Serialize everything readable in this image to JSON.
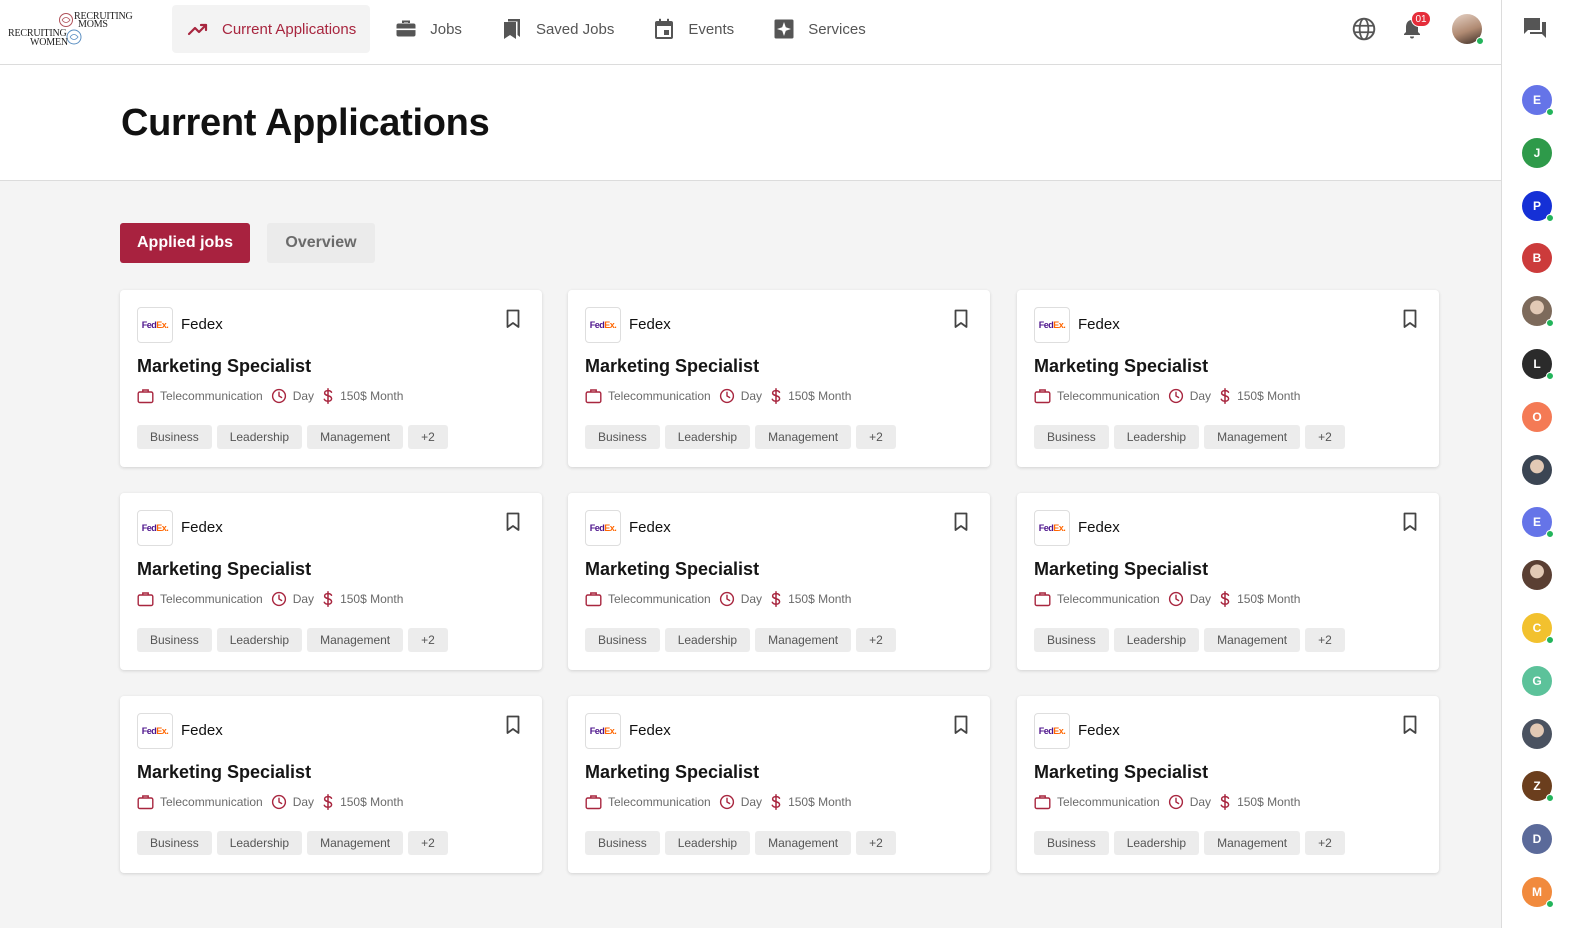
{
  "logo": {
    "line1": "RECRUITING",
    "line2": "MOMS",
    "line3": "RECRUITING",
    "line4": "WOMEN"
  },
  "nav": {
    "items": [
      {
        "label": "Current Applications",
        "icon": "trending-up-icon"
      },
      {
        "label": "Jobs",
        "icon": "briefcase-icon"
      },
      {
        "label": "Saved Jobs",
        "icon": "bookmarks-icon"
      },
      {
        "label": "Events",
        "icon": "calendar-icon"
      },
      {
        "label": "Services",
        "icon": "sparkle-icon"
      }
    ],
    "notification_count": "01",
    "colors": {
      "accent": "#a8263f",
      "online": "#23b45b"
    }
  },
  "page": {
    "title": "Current Applications"
  },
  "tabs": {
    "applied": "Applied jobs",
    "overview": "Overview"
  },
  "jobs": [
    {
      "company": "Fedex",
      "logo_fe": "Fed",
      "logo_ex": "Ex.",
      "title": "Marketing Specialist",
      "industry": "Telecommunication",
      "shift": "Day",
      "salary": "150$ Month",
      "tags": [
        "Business",
        "Leadership",
        "Management",
        "+2"
      ]
    },
    {
      "company": "Fedex",
      "logo_fe": "Fed",
      "logo_ex": "Ex.",
      "title": "Marketing Specialist",
      "industry": "Telecommunication",
      "shift": "Day",
      "salary": "150$ Month",
      "tags": [
        "Business",
        "Leadership",
        "Management",
        "+2"
      ]
    },
    {
      "company": "Fedex",
      "logo_fe": "Fed",
      "logo_ex": "Ex.",
      "title": "Marketing Specialist",
      "industry": "Telecommunication",
      "shift": "Day",
      "salary": "150$ Month",
      "tags": [
        "Business",
        "Leadership",
        "Management",
        "+2"
      ]
    },
    {
      "company": "Fedex",
      "logo_fe": "Fed",
      "logo_ex": "Ex.",
      "title": "Marketing Specialist",
      "industry": "Telecommunication",
      "shift": "Day",
      "salary": "150$ Month",
      "tags": [
        "Business",
        "Leadership",
        "Management",
        "+2"
      ]
    },
    {
      "company": "Fedex",
      "logo_fe": "Fed",
      "logo_ex": "Ex.",
      "title": "Marketing Specialist",
      "industry": "Telecommunication",
      "shift": "Day",
      "salary": "150$ Month",
      "tags": [
        "Business",
        "Leadership",
        "Management",
        "+2"
      ]
    },
    {
      "company": "Fedex",
      "logo_fe": "Fed",
      "logo_ex": "Ex.",
      "title": "Marketing Specialist",
      "industry": "Telecommunication",
      "shift": "Day",
      "salary": "150$ Month",
      "tags": [
        "Business",
        "Leadership",
        "Management",
        "+2"
      ]
    },
    {
      "company": "Fedex",
      "logo_fe": "Fed",
      "logo_ex": "Ex.",
      "title": "Marketing Specialist",
      "industry": "Telecommunication",
      "shift": "Day",
      "salary": "150$ Month",
      "tags": [
        "Business",
        "Leadership",
        "Management",
        "+2"
      ]
    },
    {
      "company": "Fedex",
      "logo_fe": "Fed",
      "logo_ex": "Ex.",
      "title": "Marketing Specialist",
      "industry": "Telecommunication",
      "shift": "Day",
      "salary": "150$ Month",
      "tags": [
        "Business",
        "Leadership",
        "Management",
        "+2"
      ]
    },
    {
      "company": "Fedex",
      "logo_fe": "Fed",
      "logo_ex": "Ex.",
      "title": "Marketing Specialist",
      "industry": "Telecommunication",
      "shift": "Day",
      "salary": "150$ Month",
      "tags": [
        "Business",
        "Leadership",
        "Management",
        "+2"
      ]
    }
  ],
  "contacts": [
    {
      "initial": "E",
      "color": "#6574e8",
      "online": true
    },
    {
      "initial": "J",
      "color": "#2e9a4a",
      "online": false
    },
    {
      "initial": "P",
      "color": "#1530d6",
      "online": true
    },
    {
      "initial": "B",
      "color": "#cc3b3b",
      "online": false
    },
    {
      "initial": "",
      "color": "#7d6a5b",
      "online": true,
      "photo": true
    },
    {
      "initial": "L",
      "color": "#2b2b2b",
      "online": true
    },
    {
      "initial": "O",
      "color": "#f47a55",
      "online": false
    },
    {
      "initial": "",
      "color": "#3b4553",
      "online": false,
      "photo": true
    },
    {
      "initial": "E",
      "color": "#6574e8",
      "online": true
    },
    {
      "initial": "",
      "color": "#5a3f33",
      "online": false,
      "photo": true
    },
    {
      "initial": "C",
      "color": "#f2c12e",
      "online": true
    },
    {
      "initial": "G",
      "color": "#5cc29a",
      "online": false
    },
    {
      "initial": "",
      "color": "#4a5260",
      "online": false,
      "photo": true
    },
    {
      "initial": "Z",
      "color": "#6b3e1d",
      "online": true
    },
    {
      "initial": "D",
      "color": "#5b6a9a",
      "online": false
    },
    {
      "initial": "M",
      "color": "#f18a3d",
      "online": true
    }
  ]
}
